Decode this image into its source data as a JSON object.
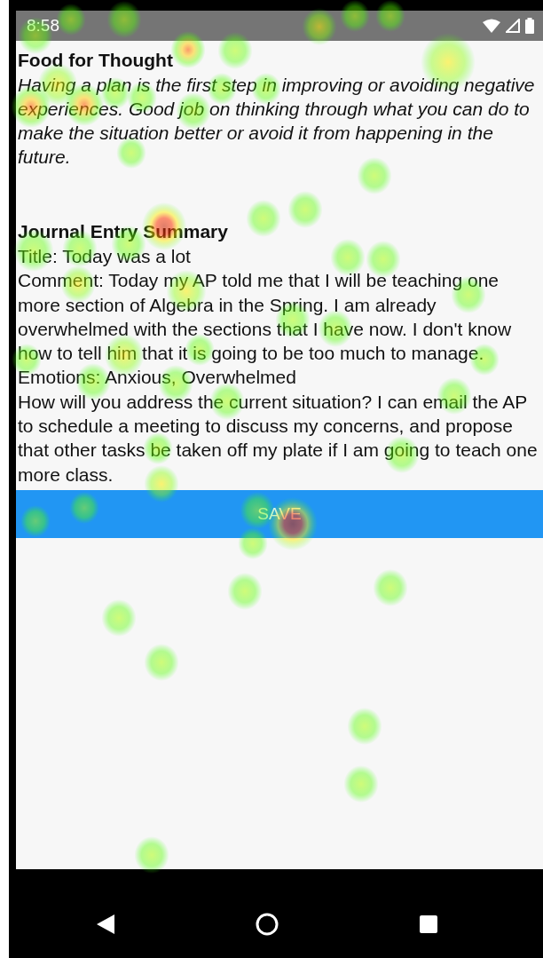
{
  "status_bar": {
    "time": "8:58"
  },
  "food_for_thought": {
    "title": "Food for Thought",
    "body": "Having a plan is the first step in improving or avoiding negative experiences. Good job on thinking through what you can do to make the situation better or avoid it from happening in the future."
  },
  "summary": {
    "title": "Journal Entry Summary",
    "lines": [
      "Title: Today was a lot",
      "Comment: Today my AP told me that I will be teaching one more section of Algebra in the Spring. I am already overwhelmed with the sections that I have now. I don't know how to tell him that it is going to be too much to manage.",
      "Emotions: Anxious, Overwhelmed",
      "How will you address the current situation? I can email the AP to schedule a meeting to discuss my concerns, and propose that other tasks be taken off my plate if I am going to teach one more class."
    ]
  },
  "save_button": {
    "label": "SAVE"
  }
}
